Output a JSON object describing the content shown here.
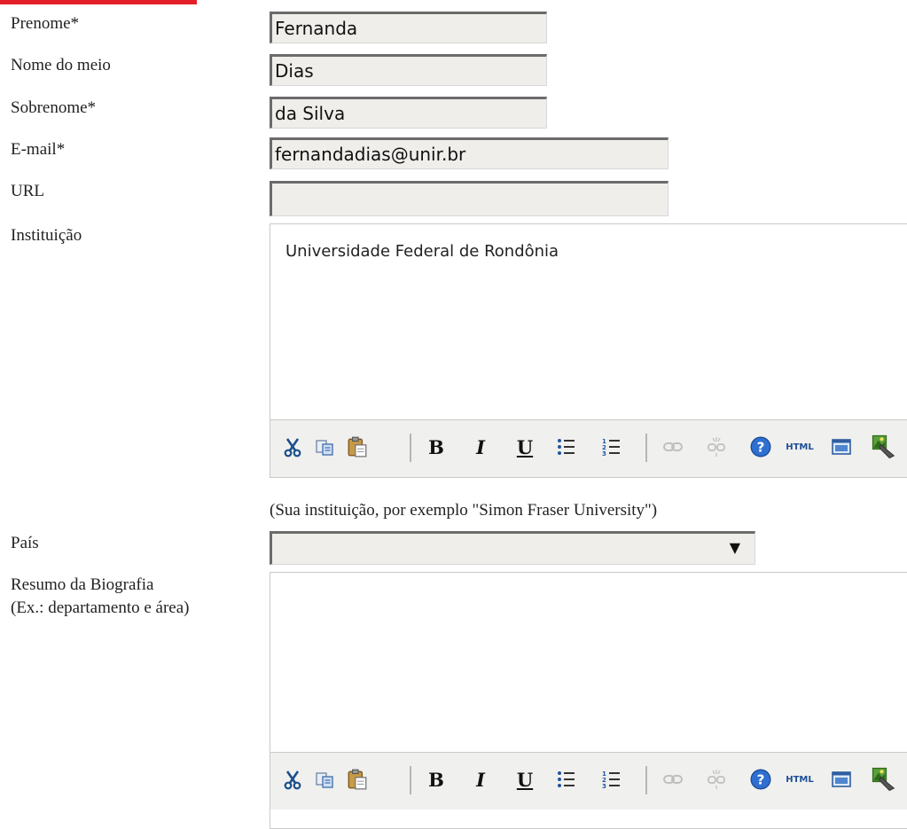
{
  "form": {
    "first_name": {
      "label": "Prenome*",
      "value": "Fernanda"
    },
    "middle_name": {
      "label": "Nome do meio",
      "value": "Dias"
    },
    "last_name": {
      "label": "Sobrenome*",
      "value": "da Silva"
    },
    "email": {
      "label": "E-mail*",
      "value": "fernandadias@unir.br"
    },
    "url": {
      "label": "URL",
      "value": ""
    },
    "affiliation": {
      "label": "Instituição",
      "value": "Universidade Federal de Rondônia",
      "hint": "(Sua instituição, por exemplo \"Simon Fraser University\")"
    },
    "country": {
      "label": "País",
      "selected": ""
    },
    "bio": {
      "label_line1": "Resumo da Biografia",
      "label_line2": "(Ex.: departamento e área)",
      "value": ""
    }
  },
  "toolbar": {
    "bold": "B",
    "italic": "I",
    "underline": "U",
    "html": "HTML",
    "icons": [
      "cut-icon",
      "copy-icon",
      "paste-icon",
      "bold-icon",
      "italic-icon",
      "underline-icon",
      "bullet-list-icon",
      "numbered-list-icon",
      "link-icon",
      "unlink-icon",
      "help-icon",
      "html-icon",
      "fullscreen-icon",
      "image-icon"
    ]
  },
  "colors": {
    "accent": "#e41e26",
    "input_bg": "#efeeea",
    "toolbar_bg": "#f0f0ee"
  }
}
